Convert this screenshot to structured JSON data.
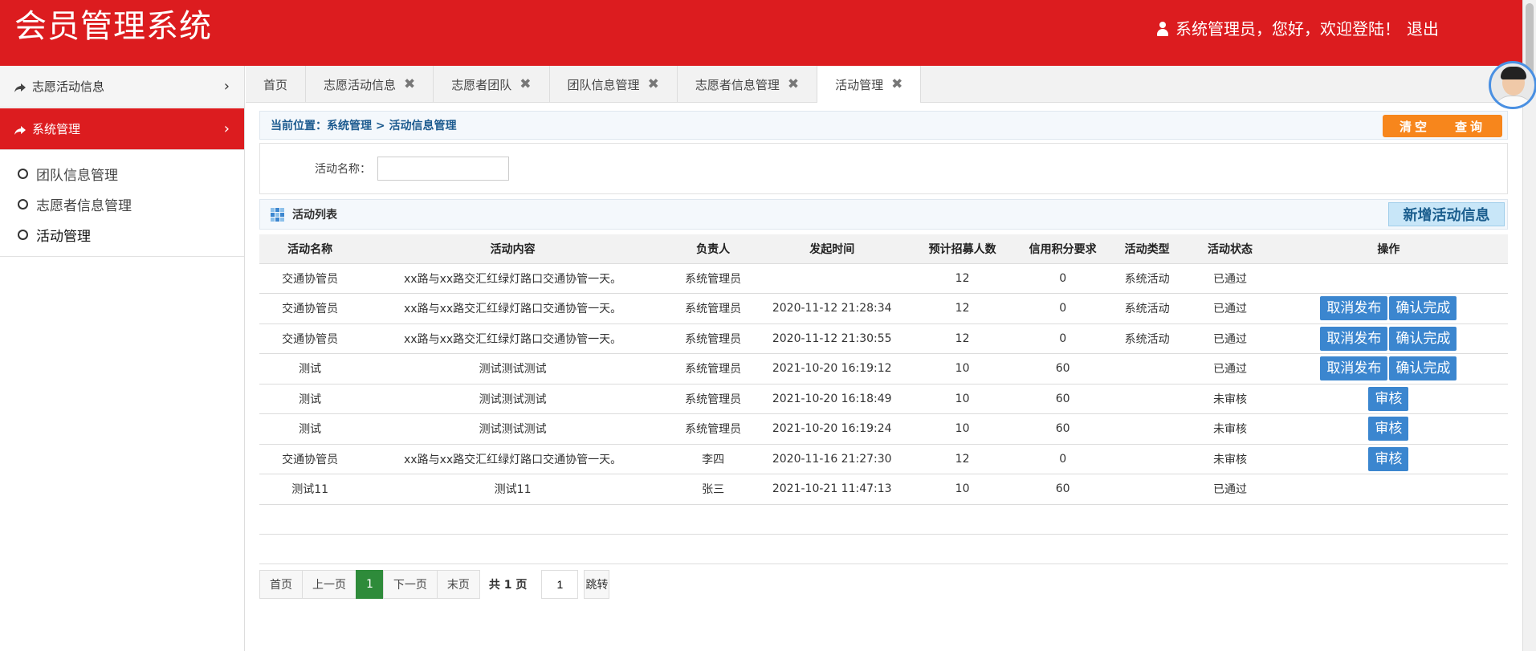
{
  "header": {
    "title": "会员管理系统",
    "user_greeting": "系统管理员，您好，欢迎登陆！",
    "logout": "退出"
  },
  "sidebar": {
    "groups": [
      {
        "label": "志愿活动信息"
      },
      {
        "label": "系统管理"
      }
    ],
    "items": [
      {
        "label": "团队信息管理"
      },
      {
        "label": "志愿者信息管理"
      },
      {
        "label": "活动管理"
      }
    ]
  },
  "tabs": [
    {
      "label": "首页"
    },
    {
      "label": "志愿活动信息"
    },
    {
      "label": "志愿者团队"
    },
    {
      "label": "团队信息管理"
    },
    {
      "label": "志愿者信息管理"
    },
    {
      "label": "活动管理"
    }
  ],
  "breadcrumb": {
    "prefix": "当前位置：",
    "path1": "系统管理",
    "sep": " > ",
    "path2": "活动信息管理"
  },
  "actions": {
    "clear": "清空",
    "query": "查询"
  },
  "search": {
    "label": "活动名称：",
    "value": "",
    "placeholder": ""
  },
  "list": {
    "title": "活动列表",
    "add_button": "新增活动信息"
  },
  "table": {
    "columns": [
      "活动名称",
      "活动内容",
      "负责人",
      "发起时间",
      "预计招募人数",
      "信用积分要求",
      "活动类型",
      "活动状态",
      "操作"
    ],
    "rows": [
      {
        "name": "交通协管员",
        "content": "xx路与xx路交汇红绿灯路口交通协管一天。",
        "owner": "系统管理员",
        "time": "",
        "count": "12",
        "credit": "0",
        "type": "系统活动",
        "status": "已通过",
        "ops": []
      },
      {
        "name": "交通协管员",
        "content": "xx路与xx路交汇红绿灯路口交通协管一天。",
        "owner": "系统管理员",
        "time": "2020-11-12 21:28:34",
        "count": "12",
        "credit": "0",
        "type": "系统活动",
        "status": "已通过",
        "ops": [
          "取消发布",
          "确认完成"
        ]
      },
      {
        "name": "交通协管员",
        "content": "xx路与xx路交汇红绿灯路口交通协管一天。",
        "owner": "系统管理员",
        "time": "2020-11-12 21:30:55",
        "count": "12",
        "credit": "0",
        "type": "系统活动",
        "status": "已通过",
        "ops": [
          "取消发布",
          "确认完成"
        ]
      },
      {
        "name": "测试",
        "content": "测试测试测试",
        "owner": "系统管理员",
        "time": "2021-10-20 16:19:12",
        "count": "10",
        "credit": "60",
        "type": "",
        "status": "已通过",
        "ops": [
          "取消发布",
          "确认完成"
        ]
      },
      {
        "name": "测试",
        "content": "测试测试测试",
        "owner": "系统管理员",
        "time": "2021-10-20 16:18:49",
        "count": "10",
        "credit": "60",
        "type": "",
        "status": "未审核",
        "ops": [
          "审核"
        ]
      },
      {
        "name": "测试",
        "content": "测试测试测试",
        "owner": "系统管理员",
        "time": "2021-10-20 16:19:24",
        "count": "10",
        "credit": "60",
        "type": "",
        "status": "未审核",
        "ops": [
          "审核"
        ]
      },
      {
        "name": "交通协管员",
        "content": "xx路与xx路交汇红绿灯路口交通协管一天。",
        "owner": "李四",
        "time": "2020-11-16 21:27:30",
        "count": "12",
        "credit": "0",
        "type": "",
        "status": "未审核",
        "ops": [
          "审核"
        ]
      },
      {
        "name": "测试11",
        "content": "测试11",
        "owner": "张三",
        "time": "2021-10-21 11:47:13",
        "count": "10",
        "credit": "60",
        "type": "",
        "status": "已通过",
        "ops": []
      }
    ]
  },
  "pager": {
    "first": "首页",
    "prev": "上一页",
    "current": "1",
    "next": "下一页",
    "last": "末页",
    "total": "共 1 页",
    "jump_value": "1",
    "jump": "跳转"
  },
  "colors": {
    "brand_red": "#dc1c1f",
    "orange": "#f7861c",
    "blue": "#3b86cf",
    "green": "#2e8b3a"
  }
}
